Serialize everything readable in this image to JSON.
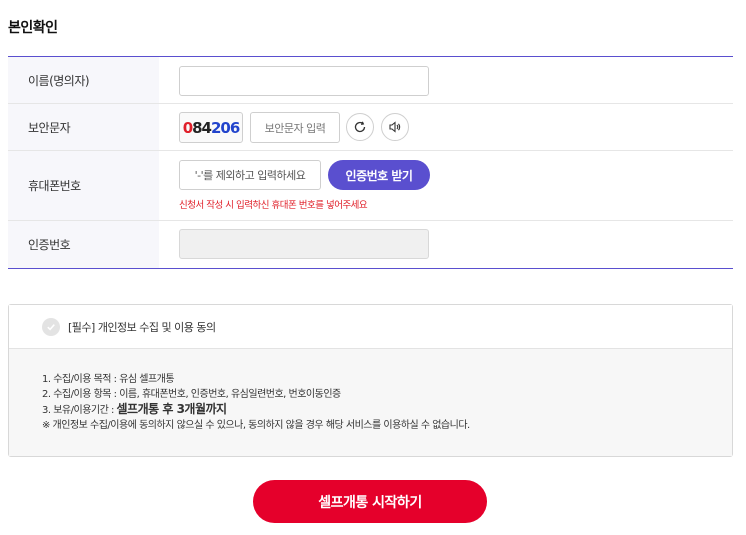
{
  "title": "본인확인",
  "form": {
    "name_label": "이름(명의자)",
    "name_value": "",
    "captcha_label": "보안문자",
    "captcha_code": [
      "0",
      "84",
      "206"
    ],
    "captcha_input_placeholder": "보안문자 입력",
    "phone_label": "휴대폰번호",
    "phone_placeholder": "'-'를 제외하고 입력하세요",
    "cert_button": "인증번호 받기",
    "phone_note": "신청서 작성 시 입력하신 휴대폰 번호를 넣어주세요",
    "cert_label": "인증번호",
    "cert_value": ""
  },
  "agreement": {
    "label": "[필수] 개인정보 수집 및 이용 동의",
    "checked": false,
    "line1": "1. 수집/이용 목적 : 유심 셀프개통",
    "line2": "2. 수집/이용 항목 : 이름, 휴대폰번호, 인증번호, 유심일련번호, 번호이동인증",
    "line3_prefix": "3. 보유/이용기간 : ",
    "line3_strong": "셀프개통 후 3개월까지",
    "line4": "※ 개인정보 수집/이용에 동의하지 않으실 수 있으나, 동의하지 않을 경우 해당 서비스를 이용하실 수 없습니다."
  },
  "start_button": "셀프개통 시작하기",
  "colors": {
    "accent": "#5a4fcf",
    "primary_red": "#e5002b",
    "note_red": "#e0202a"
  }
}
